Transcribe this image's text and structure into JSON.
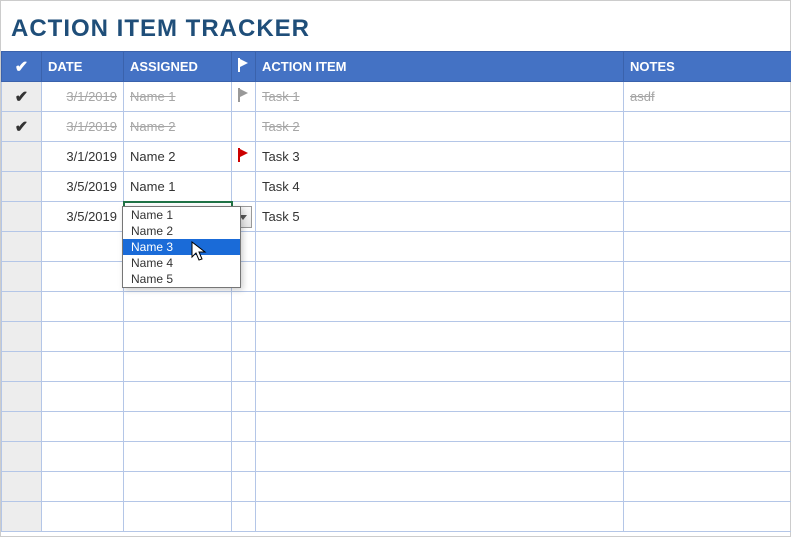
{
  "title": "ACTION ITEM TRACKER",
  "columns": {
    "check": "",
    "date": "DATE",
    "assigned": "ASSIGNED",
    "flag": "",
    "item": "ACTION ITEM",
    "notes": "NOTES"
  },
  "rows": [
    {
      "done": true,
      "date": "3/1/2019",
      "assigned": "Name 1",
      "flag": "gray",
      "item": "Task 1",
      "notes": "asdf"
    },
    {
      "done": true,
      "date": "3/1/2019",
      "assigned": "Name 2",
      "flag": "",
      "item": "Task 2",
      "notes": ""
    },
    {
      "done": false,
      "date": "3/1/2019",
      "assigned": "Name 2",
      "flag": "red",
      "item": "Task 3",
      "notes": ""
    },
    {
      "done": false,
      "date": "3/5/2019",
      "assigned": "Name 1",
      "flag": "",
      "item": "Task 4",
      "notes": ""
    },
    {
      "done": false,
      "date": "3/5/2019",
      "assigned": "Name 3",
      "flag": "",
      "item": "Task 5",
      "notes": "",
      "active": true
    }
  ],
  "empty_rows": 10,
  "dropdown": {
    "options": [
      "Name 1",
      "Name 2",
      "Name 3",
      "Name 4",
      "Name 5"
    ],
    "highlighted": "Name 3"
  }
}
